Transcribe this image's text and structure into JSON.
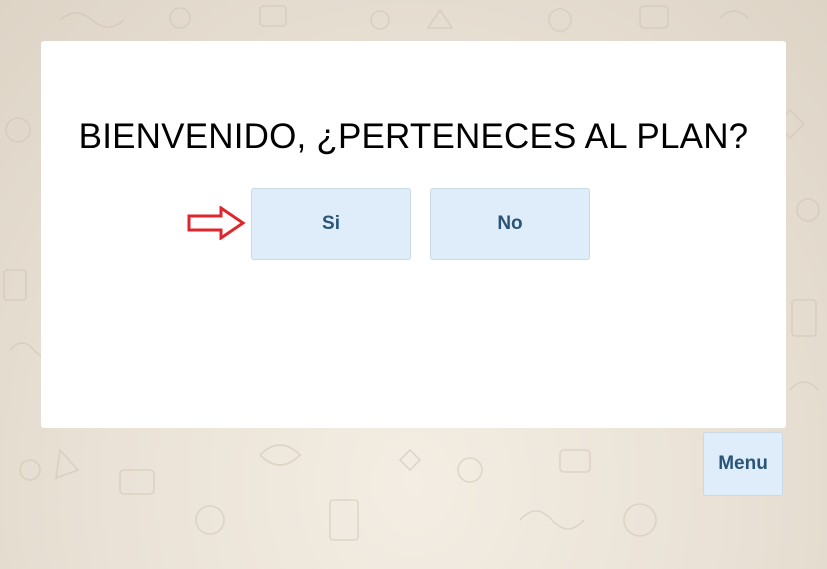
{
  "prompt": {
    "title": "BIENVENIDO, ¿PERTENECES AL PLAN?"
  },
  "buttons": {
    "yes_label": "Si",
    "no_label": "No",
    "menu_label": "Menu"
  },
  "colors": {
    "button_bg": "#deedf9",
    "button_text": "#2a5478",
    "arrow": "#e0262d",
    "card_bg": "#ffffff"
  },
  "icons": {
    "pointer": "arrow-right-icon"
  }
}
